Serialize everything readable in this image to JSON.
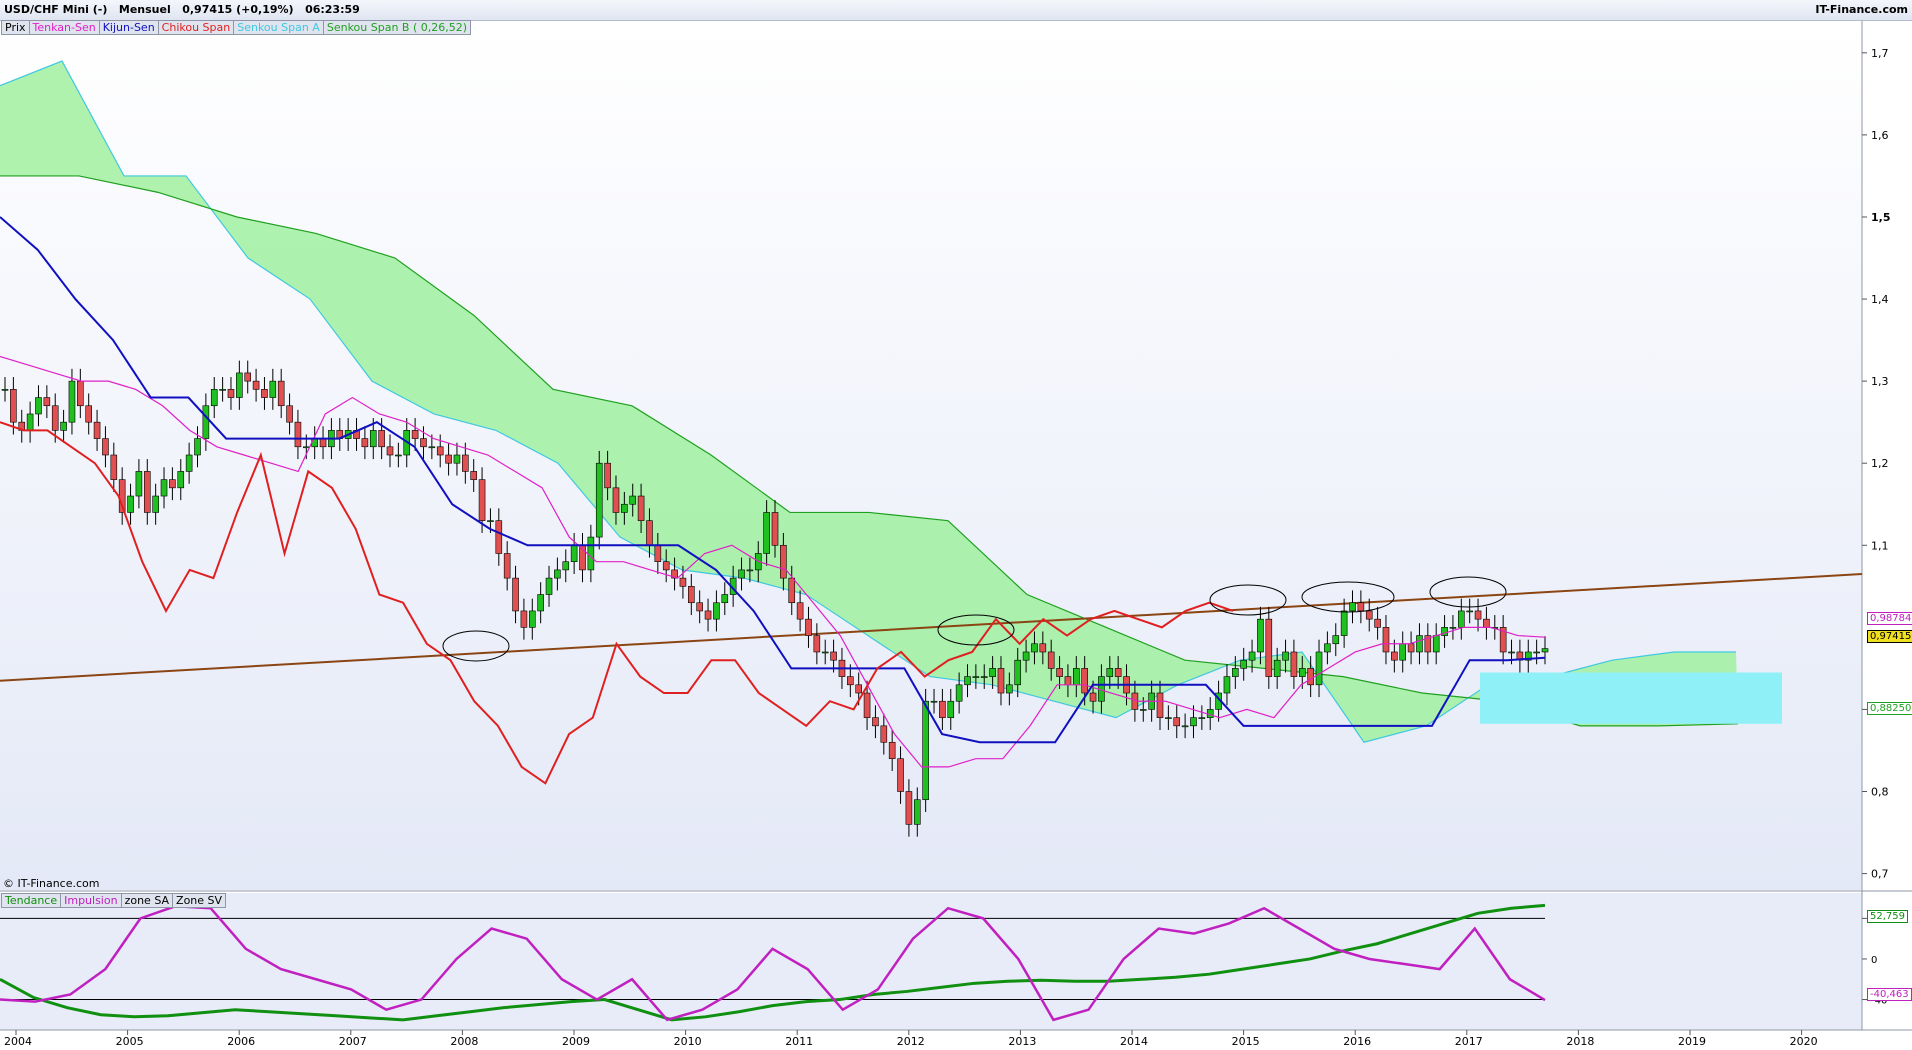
{
  "header": {
    "title": "USD/CHF Mini (-)   Mensuel   0,97415 (+0,19%)   06:23:59",
    "brand": "IT-Finance.com"
  },
  "legend_main": [
    {
      "label": "Prix",
      "color": "#000000"
    },
    {
      "label": "Tenkan-Sen",
      "color": "#e020c8"
    },
    {
      "label": "Kijun-Sen",
      "color": "#1010c0"
    },
    {
      "label": "Chikou Span",
      "color": "#e02020"
    },
    {
      "label": "Senkou Span A",
      "color": "#40c8e0"
    },
    {
      "label": "Senkou Span B ( 0,26,52)",
      "color": "#20a020"
    }
  ],
  "legend_sub": [
    {
      "label": "Tendance",
      "color": "#109010"
    },
    {
      "label": "Impulsion",
      "color": "#c020c0"
    },
    {
      "label": "zone SA",
      "color": "#000000"
    },
    {
      "label": "Zone SV",
      "color": "#000000"
    }
  ],
  "copyright": "© IT-Finance.com",
  "colors": {
    "candle_up": "#20c020",
    "candle_down": "#e05050",
    "tenkan": "#e020c8",
    "kijun": "#1010c0",
    "chikou": "#e02020",
    "cloud_green": "#a0f0a0",
    "cloud_cyan": "#90f0f8",
    "trendline": "#8b4513"
  },
  "price_tags": [
    {
      "text": "0,98784",
      "color": "#c020c0"
    },
    {
      "text": "0,97415",
      "color": "#000000",
      "bg": "#f0e020"
    },
    {
      "text": "0,88250",
      "color": "#20a020"
    }
  ],
  "osc_tags": [
    {
      "text": "52,759",
      "color": "#109010"
    },
    {
      "text": "-40,463",
      "color": "#c020c0"
    }
  ],
  "chart_data": [
    {
      "type": "candlestick",
      "title": "USD/CHF Mini (-) Mensuel",
      "x_ticks": [
        "2004",
        "2005",
        "2006",
        "2007",
        "2008",
        "2009",
        "2010",
        "2011",
        "2012",
        "2013",
        "2014",
        "2015",
        "2016",
        "2017",
        "2018",
        "2019",
        "2020"
      ],
      "y_ticks": [
        "1,7",
        "1,6",
        "1,5",
        "1,4",
        "1,3",
        "1,2",
        "1,1",
        "0,9",
        "0,8",
        "0,7"
      ],
      "ylim": [
        0.68,
        1.74
      ],
      "grid": false,
      "series": [
        {
          "name": "Prix",
          "values": [
            1.29,
            1.25,
            1.24,
            1.26,
            1.28,
            1.27,
            1.24,
            1.25,
            1.3,
            1.27,
            1.25,
            1.23,
            1.21,
            1.18,
            1.14,
            1.16,
            1.19,
            1.14,
            1.16,
            1.18,
            1.17,
            1.19,
            1.21,
            1.23,
            1.27,
            1.29,
            1.29,
            1.28,
            1.31,
            1.3,
            1.29,
            1.28,
            1.3,
            1.27,
            1.25,
            1.22,
            1.22,
            1.23,
            1.22,
            1.24,
            1.23,
            1.24,
            1.23,
            1.22,
            1.24,
            1.22,
            1.21,
            1.21,
            1.24,
            1.23,
            1.22,
            1.22,
            1.21,
            1.2,
            1.21,
            1.19,
            1.18,
            1.13,
            1.13,
            1.09,
            1.06,
            1.02,
            1.0,
            1.02,
            1.04,
            1.06,
            1.07,
            1.08,
            1.1,
            1.07,
            1.11,
            1.2,
            1.17,
            1.14,
            1.15,
            1.16,
            1.13,
            1.1,
            1.08,
            1.07,
            1.06,
            1.05,
            1.03,
            1.02,
            1.01,
            1.03,
            1.04,
            1.06,
            1.07,
            1.07,
            1.09,
            1.14,
            1.1,
            1.06,
            1.03,
            1.01,
            0.99,
            0.97,
            0.97,
            0.96,
            0.94,
            0.93,
            0.92,
            0.89,
            0.88,
            0.86,
            0.84,
            0.8,
            0.76,
            0.79,
            0.91,
            0.91,
            0.89,
            0.91,
            0.93,
            0.94,
            0.94,
            0.94,
            0.95,
            0.92,
            0.93,
            0.96,
            0.97,
            0.98,
            0.97,
            0.95,
            0.94,
            0.93,
            0.95,
            0.92,
            0.91,
            0.94,
            0.95,
            0.94,
            0.92,
            0.9,
            0.9,
            0.92,
            0.89,
            0.89,
            0.88,
            0.88,
            0.89,
            0.89,
            0.9,
            0.92,
            0.94,
            0.95,
            0.96,
            0.97,
            1.01,
            0.94,
            0.96,
            0.97,
            0.94,
            0.95,
            0.93,
            0.97,
            0.98,
            0.99,
            1.02,
            1.03,
            1.02,
            1.01,
            1.0,
            0.97,
            0.96,
            0.98,
            0.97,
            0.99,
            0.97,
            0.99,
            1.0,
            1.0,
            1.02,
            1.02,
            1.01,
            1.0,
            1.0,
            0.97,
            0.97,
            0.96,
            0.97,
            0.97,
            0.97415
          ]
        },
        {
          "name": "Tenkan-Sen",
          "values": [
            1.33,
            1.32,
            1.31,
            1.3,
            1.3,
            1.29,
            1.27,
            1.24,
            1.22,
            1.21,
            1.2,
            1.19,
            1.26,
            1.28,
            1.26,
            1.25,
            1.23,
            1.22,
            1.21,
            1.19,
            1.17,
            1.11,
            1.08,
            1.08,
            1.07,
            1.06,
            1.09,
            1.1,
            1.08,
            1.07,
            1.03,
            0.99,
            0.93,
            0.87,
            0.83,
            0.83,
            0.84,
            0.84,
            0.88,
            0.93,
            0.93,
            0.92,
            0.91,
            0.91,
            0.9,
            0.89,
            0.9,
            0.89,
            0.93,
            0.95,
            0.97,
            0.98,
            0.98,
            0.99,
            1.0,
            1.0,
            0.99,
            0.988
          ]
        },
        {
          "name": "Kijun-Sen",
          "values": [
            1.5,
            1.46,
            1.4,
            1.35,
            1.28,
            1.28,
            1.23,
            1.23,
            1.23,
            1.23,
            1.25,
            1.22,
            1.15,
            1.12,
            1.1,
            1.1,
            1.1,
            1.1,
            1.1,
            1.07,
            1.02,
            0.95,
            0.95,
            0.95,
            0.95,
            0.87,
            0.86,
            0.86,
            0.86,
            0.93,
            0.93,
            0.93,
            0.93,
            0.88,
            0.88,
            0.88,
            0.88,
            0.88,
            0.88,
            0.96,
            0.96,
            0.963
          ]
        },
        {
          "name": "Chikou Span",
          "values": [
            1.25,
            1.24,
            1.24,
            1.22,
            1.2,
            1.16,
            1.08,
            1.02,
            1.07,
            1.06,
            1.14,
            1.21,
            1.09,
            1.19,
            1.17,
            1.12,
            1.04,
            1.03,
            0.98,
            0.96,
            0.91,
            0.88,
            0.83,
            0.81,
            0.87,
            0.89,
            0.98,
            0.94,
            0.92,
            0.92,
            0.96,
            0.96,
            0.92,
            0.9,
            0.88,
            0.91,
            0.9,
            0.95,
            0.97,
            0.94,
            0.96,
            0.97,
            1.01,
            0.98,
            1.01,
            0.99,
            1.01,
            1.02,
            1.01,
            1.0,
            1.02,
            1.03,
            1.02
          ]
        },
        {
          "name": "Senkou Span A",
          "values": [
            1.66,
            1.69,
            1.55,
            1.55,
            1.45,
            1.4,
            1.3,
            1.26,
            1.24,
            1.2,
            1.11,
            1.07,
            1.06,
            1.04,
            0.99,
            0.94,
            0.93,
            0.91,
            0.89,
            0.93,
            0.96,
            0.97,
            0.86,
            0.88,
            0.93,
            0.94,
            0.96,
            0.97,
            0.97
          ]
        },
        {
          "name": "Senkou Span B",
          "values": [
            1.55,
            1.55,
            1.53,
            1.5,
            1.48,
            1.45,
            1.38,
            1.29,
            1.27,
            1.21,
            1.14,
            1.14,
            1.13,
            1.04,
            1.0,
            0.96,
            0.95,
            0.94,
            0.92,
            0.91,
            0.88,
            0.88,
            0.8825
          ]
        }
      ]
    },
    {
      "type": "line",
      "title": "",
      "y_ticks": [
        "40",
        "0",
        "-40"
      ],
      "ylim": [
        -70,
        65
      ],
      "series": [
        {
          "name": "Tendance",
          "values": [
            -20,
            -38,
            -48,
            -55,
            -57,
            -56,
            -53,
            -50,
            -52,
            -54,
            -56,
            -58,
            -60,
            -56,
            -52,
            -48,
            -45,
            -42,
            -40,
            -50,
            -60,
            -57,
            -52,
            -46,
            -42,
            -40,
            -35,
            -32,
            -28,
            -24,
            -22,
            -21,
            -22,
            -22,
            -20,
            -18,
            -15,
            -10,
            -5,
            0,
            8,
            15,
            25,
            35,
            45,
            50,
            52.759
          ]
        },
        {
          "name": "Impulsion",
          "values": [
            -40,
            -42,
            -35,
            -10,
            40,
            52,
            50,
            10,
            -10,
            -20,
            -30,
            -50,
            -40,
            0,
            30,
            20,
            -20,
            -40,
            -20,
            -60,
            -50,
            -30,
            10,
            -10,
            -50,
            -30,
            20,
            50,
            40,
            0,
            -60,
            -50,
            0,
            30,
            25,
            35,
            50,
            30,
            10,
            0,
            -5,
            -10,
            30,
            -20,
            -40.463
          ]
        }
      ]
    }
  ]
}
